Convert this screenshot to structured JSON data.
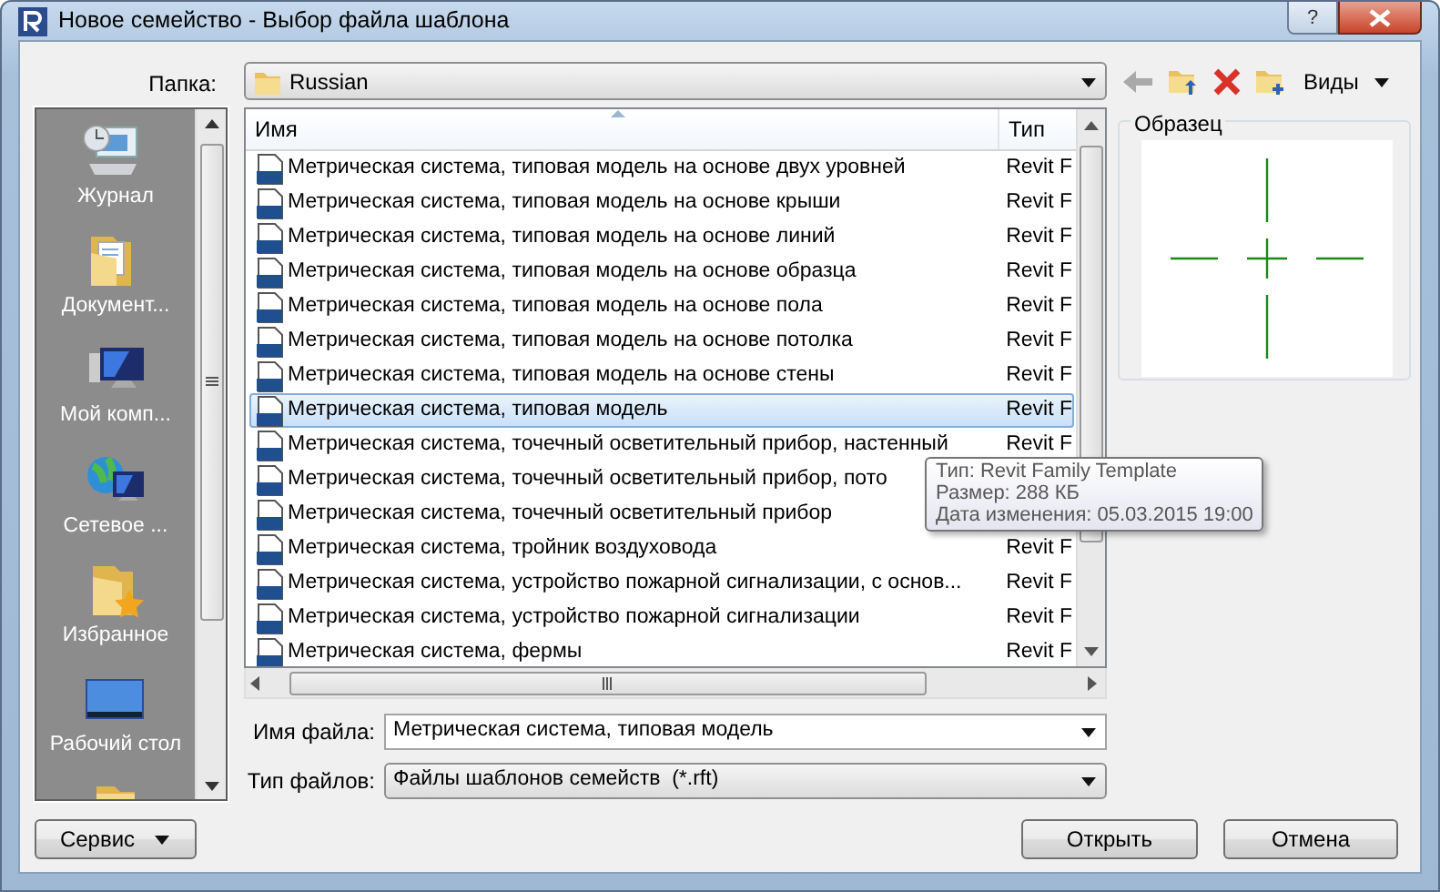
{
  "window": {
    "title": "Новое семейство - Выбор файла шаблона",
    "help": "?"
  },
  "folder": {
    "label": "Папка:",
    "value": "Russian"
  },
  "toolbar": {
    "views": "Виды"
  },
  "places": [
    {
      "label": "Журнал",
      "kind": "history"
    },
    {
      "label": "Документ...",
      "kind": "documents"
    },
    {
      "label": "Мой комп...",
      "kind": "computer"
    },
    {
      "label": "Сетевое ...",
      "kind": "network"
    },
    {
      "label": "Избранное",
      "kind": "favorites"
    },
    {
      "label": "Рабочий стол",
      "kind": "desktop"
    },
    {
      "kind": "folder"
    }
  ],
  "file_list": {
    "columns": [
      "Имя",
      "Тип"
    ],
    "rows": [
      {
        "name": "Метрическая система, типовая модель на основе двух уровней",
        "type": "Revit F",
        "selected": false
      },
      {
        "name": "Метрическая система, типовая модель на основе крыши",
        "type": "Revit F",
        "selected": false
      },
      {
        "name": "Метрическая система, типовая модель на основе линий",
        "type": "Revit F",
        "selected": false
      },
      {
        "name": "Метрическая система, типовая модель на основе образца",
        "type": "Revit F",
        "selected": false
      },
      {
        "name": "Метрическая система, типовая модель на основе пола",
        "type": "Revit F",
        "selected": false
      },
      {
        "name": "Метрическая система, типовая модель на основе потолка",
        "type": "Revit F",
        "selected": false
      },
      {
        "name": "Метрическая система, типовая модель на основе стены",
        "type": "Revit F",
        "selected": false
      },
      {
        "name": "Метрическая система, типовая модель",
        "type": "Revit F",
        "selected": true
      },
      {
        "name": "Метрическая система, точечный осветительный прибор, настенный",
        "type": "Revit F",
        "selected": false
      },
      {
        "name": "Метрическая система, точечный осветительный прибор, пото",
        "selected": false
      },
      {
        "name": "Метрическая система, точечный осветительный прибор",
        "selected": false
      },
      {
        "name": "Метрическая система, тройник воздуховода",
        "type": "Revit F",
        "selected": false
      },
      {
        "name": "Метрическая система, устройство пожарной сигнализации, с основ...",
        "type": "Revit F",
        "selected": false
      },
      {
        "name": "Метрическая система, устройство пожарной сигнализации",
        "type": "Revit F",
        "selected": false
      },
      {
        "name": "Метрическая система, фермы",
        "type": "Revit F",
        "selected": false
      }
    ]
  },
  "tooltip": {
    "lines": [
      "Тип: Revit Family Template",
      "Размер: 288 КБ",
      "Дата изменения: 05.03.2015 19:00"
    ]
  },
  "preview": {
    "label": "Образец"
  },
  "file_name": {
    "label": "Имя файла:",
    "value": "Метрическая система, типовая модель"
  },
  "file_type": {
    "label": "Тип файлов:",
    "value": "Файлы шаблонов семейств  (*.rft)"
  },
  "buttons": {
    "tools": "Сервис",
    "open": "Открыть",
    "cancel": "Отмена"
  }
}
